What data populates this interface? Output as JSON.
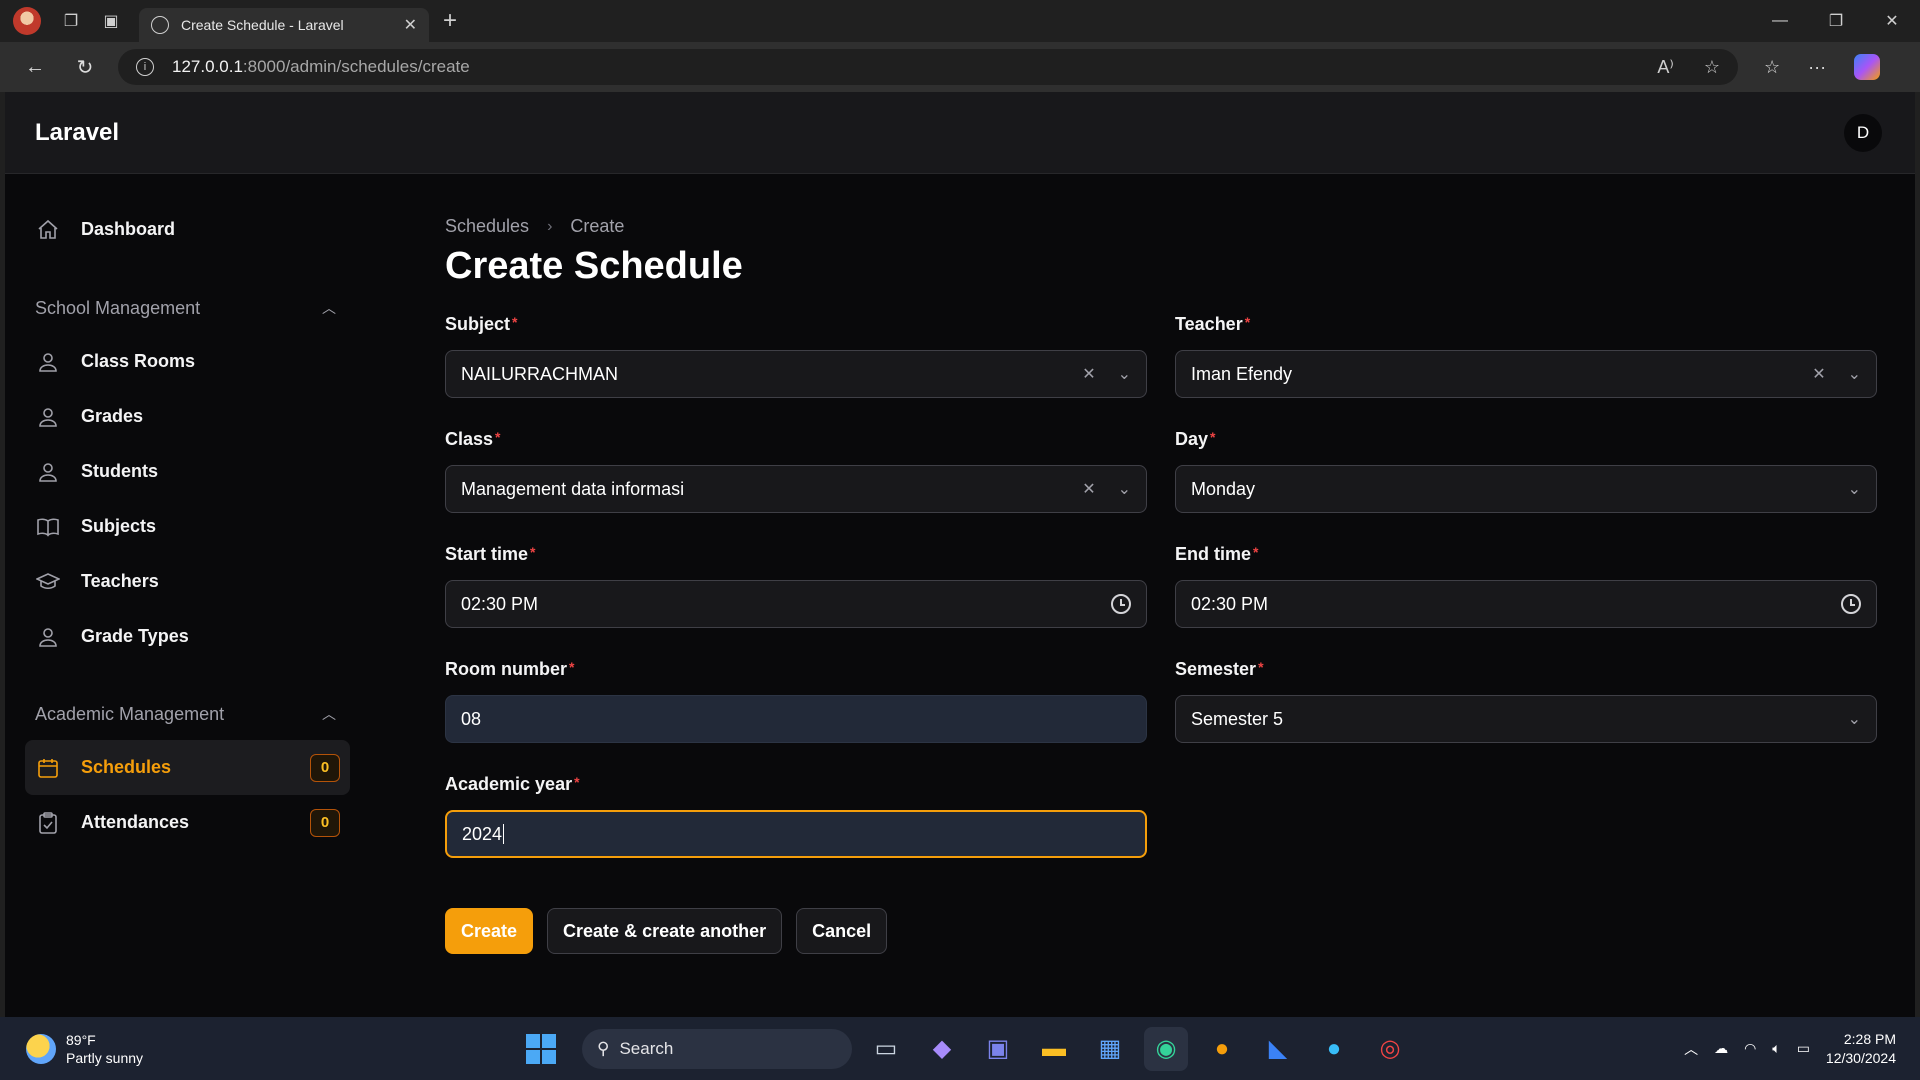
{
  "browser": {
    "tab_title": "Create Schedule - Laravel",
    "url_host": "127.0.0.1",
    "url_path": ":8000/admin/schedules/create"
  },
  "app": {
    "brand": "Laravel",
    "user_initial": "D"
  },
  "sidebar": {
    "dashboard": "Dashboard",
    "groups": [
      {
        "title": "School Management",
        "items": [
          {
            "label": "Class Rooms",
            "icon": "user-icon"
          },
          {
            "label": "Grades",
            "icon": "user-icon"
          },
          {
            "label": "Students",
            "icon": "user-icon"
          },
          {
            "label": "Subjects",
            "icon": "book-icon"
          },
          {
            "label": "Teachers",
            "icon": "graduation-cap-icon"
          },
          {
            "label": "Grade Types",
            "icon": "user-icon"
          }
        ]
      },
      {
        "title": "Academic Management",
        "items": [
          {
            "label": "Schedules",
            "icon": "calendar-icon",
            "badge": "0",
            "active": true
          },
          {
            "label": "Attendances",
            "icon": "clipboard-icon",
            "badge": "0"
          }
        ]
      }
    ]
  },
  "breadcrumb": {
    "parent": "Schedules",
    "current": "Create"
  },
  "page_title": "Create Schedule",
  "form": {
    "subject": {
      "label": "Subject",
      "value": "NAILURRACHMAN"
    },
    "teacher": {
      "label": "Teacher",
      "value": "Iman Efendy"
    },
    "class": {
      "label": "Class",
      "value": "Management data informasi"
    },
    "day": {
      "label": "Day",
      "value": "Monday"
    },
    "start_time": {
      "label": "Start time",
      "value": "02:30 PM"
    },
    "end_time": {
      "label": "End time",
      "value": "02:30 PM"
    },
    "room_number": {
      "label": "Room number",
      "value": "08"
    },
    "semester": {
      "label": "Semester",
      "value": "Semester 5"
    },
    "academic_year": {
      "label": "Academic year",
      "value": "2024"
    }
  },
  "buttons": {
    "create": "Create",
    "create_another": "Create & create another",
    "cancel": "Cancel"
  },
  "taskbar": {
    "temp": "89°F",
    "weather": "Partly sunny",
    "search": "Search",
    "time": "2:28 PM",
    "date": "12/30/2024"
  },
  "colors": {
    "accent": "#f59e0b",
    "required": "#ef4444"
  }
}
